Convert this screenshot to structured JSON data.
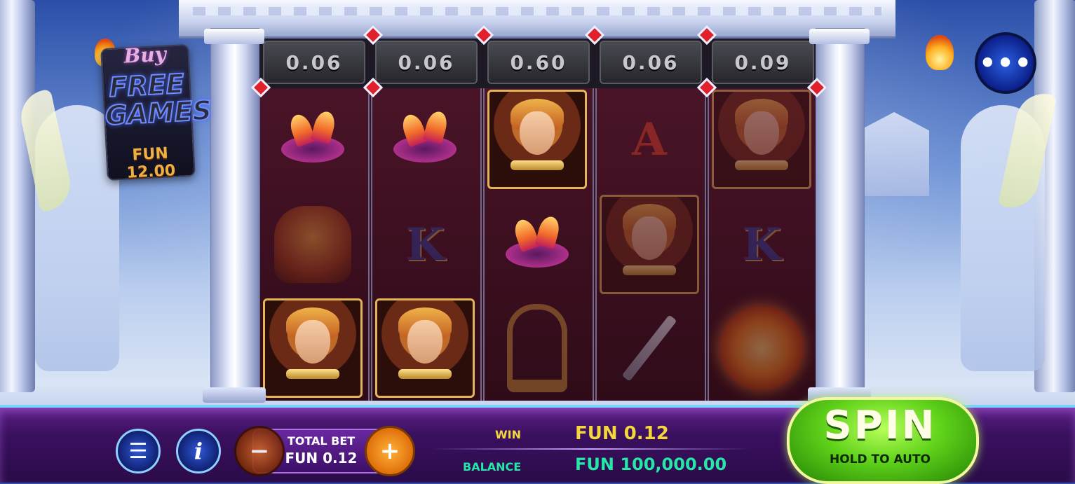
{
  "game": {
    "multipliers": [
      "0.06",
      "0.06",
      "0.60",
      "0.06",
      "0.09"
    ],
    "reels": [
      [
        "crown",
        "phoenix",
        "hero"
      ],
      [
        "crown",
        "K",
        "hero"
      ],
      [
        "hero",
        "crown",
        "lyre"
      ],
      [
        "A",
        "hero",
        "sword"
      ],
      [
        "hero",
        "K",
        "sun"
      ]
    ]
  },
  "buy_free_games": {
    "line1": "Buy",
    "line2": "FREE",
    "line3": "GAMES",
    "price": "FUN 12.00"
  },
  "menu": {
    "more_label": "•••",
    "menu_icon": "☰",
    "info_icon": "i"
  },
  "bet": {
    "label": "TOTAL BET",
    "value": "FUN 0.12",
    "minus": "−",
    "plus": "+"
  },
  "win": {
    "label": "WIN",
    "value": "FUN 0.12"
  },
  "balance": {
    "label": "BALANCE",
    "value": "FUN 100,000.00"
  },
  "spin": {
    "label": "SPIN",
    "sub": "HOLD TO AUTO"
  },
  "colors": {
    "win": "#f4d73a",
    "balance": "#27e7a8",
    "spin": "#5fd21a",
    "bar": "#3b1060"
  }
}
